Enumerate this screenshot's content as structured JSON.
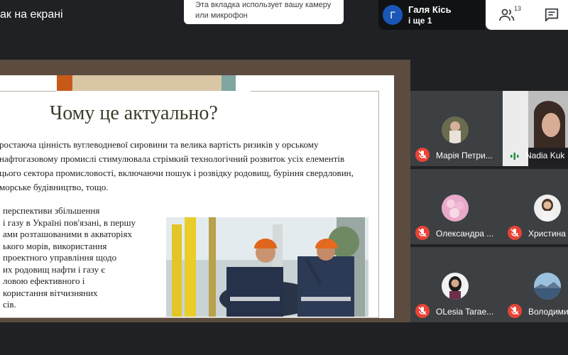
{
  "header": {
    "presentation_label": "ак на екрані",
    "toast_text": "Эта вкладка использует вашу камеру или микрофон",
    "speaker_initial": "Г",
    "speaker_name": "Галя Кісь",
    "speaker_more": "і ще 1",
    "people_count": "13"
  },
  "slide": {
    "title": "Чому це актуально?",
    "paragraph1": "ростаюча цінність вуглеводневої сировини та велика вартість ризиків у орському нафтогазовому промислі стимулювала стрімкий технологічний розвиток усіх елементів цього сектора промисловості, включаючи пошук і розвідку родовищ, буріння свердловин, морське будівництво, тощо.",
    "paragraph2_lines": [
      "перспективи збільшення",
      "і газу в Україні пов'язані, в першу",
      "ами розташованими в акваторіях",
      "ького морів, використання",
      "проектного управління щодо",
      "их родовищ нафти і газу є",
      "ловою ефективного і",
      "користання вітчизняних",
      "сів."
    ]
  },
  "participants": [
    {
      "name": "Марія Петри...",
      "muted": true
    },
    {
      "name": "Nadia Kuk",
      "muted": false,
      "speaking": true
    },
    {
      "name": "Олександра ...",
      "muted": true
    },
    {
      "name": "Христина",
      "muted": true
    },
    {
      "name": "OLesia Tarae...",
      "muted": true
    },
    {
      "name": "Володими",
      "muted": true
    }
  ],
  "colors": {
    "background": "#202124",
    "mic_muted": "#ea4335",
    "speaking": "#1e8e3e",
    "accent_blue": "#1a56b7"
  },
  "icons": {
    "people": "people-icon",
    "chat": "chat-icon",
    "mic_off": "mic-off-icon"
  }
}
